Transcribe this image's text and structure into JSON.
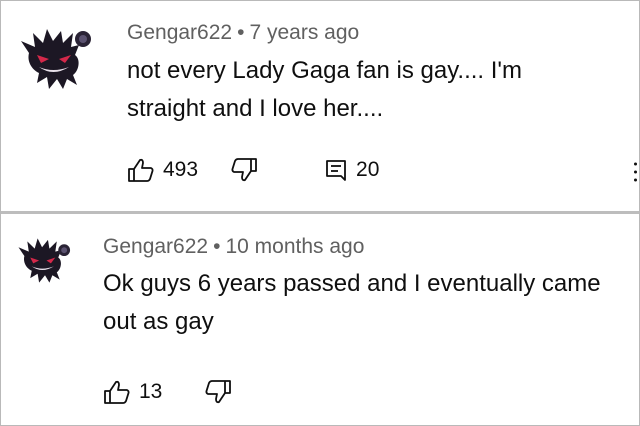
{
  "comments": [
    {
      "author": "Gengar622",
      "separator": "•",
      "time": "7 years ago",
      "text": "not every Lady Gaga fan is gay.... I'm straight and I love her....",
      "likes": "493",
      "replies": "20",
      "icons": {
        "avatar": "gengar-avatar",
        "like": "thumbs-up-icon",
        "dislike": "thumbs-down-icon",
        "reply": "reply-comment-icon",
        "menu": "more-vert-icon"
      }
    },
    {
      "author": "Gengar622",
      "separator": "•",
      "time": "10 months ago",
      "text": "Ok guys 6 years passed and I eventually came out as gay",
      "likes": "13",
      "icons": {
        "avatar": "gengar-avatar",
        "like": "thumbs-up-icon",
        "dislike": "thumbs-down-icon"
      }
    }
  ],
  "colors": {
    "meta_text": "#606060",
    "body_text": "#0f0f0f",
    "divider": "#bdbdbd",
    "avatar_body": "#1c1724",
    "avatar_eyes": "#d4284a"
  }
}
